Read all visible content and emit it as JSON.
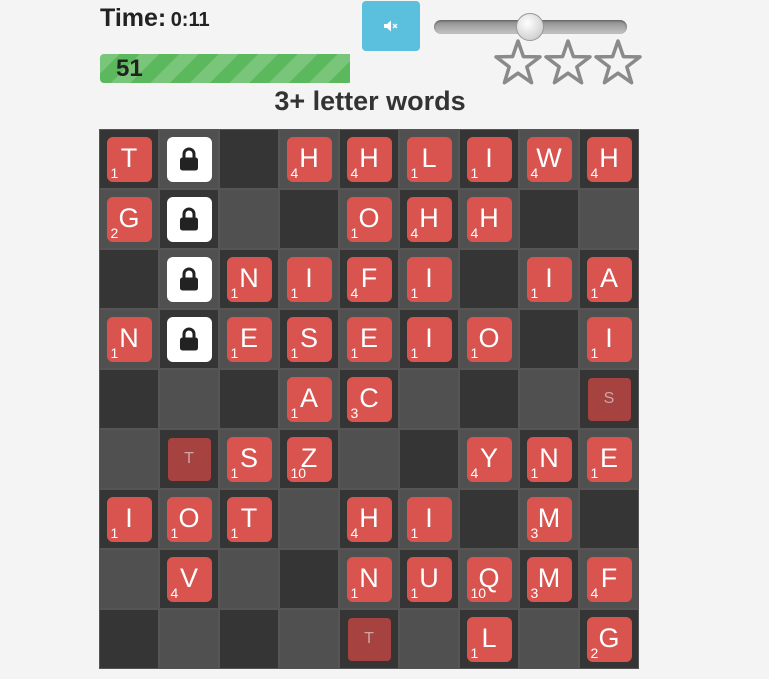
{
  "header": {
    "time_label": "Time:",
    "time_value": "0:11",
    "mute_icon": "speaker-muted-icon",
    "volume": 0.5
  },
  "progress": {
    "value": "51",
    "fraction": 0.5
  },
  "stars": {
    "total": 3,
    "filled": 0
  },
  "heading": "3+ letter words",
  "colors": {
    "tile": "#d9534f",
    "ghost_tile": "#a64341",
    "mute_button": "#5bc0de",
    "progress": "#5cb85c"
  },
  "board": {
    "rows": [
      [
        {
          "t": "tile",
          "l": "T",
          "s": "1"
        },
        {
          "t": "lock"
        },
        {
          "t": "empty"
        },
        {
          "t": "tile",
          "l": "H",
          "s": "4"
        },
        {
          "t": "tile",
          "l": "H",
          "s": "4"
        },
        {
          "t": "tile",
          "l": "L",
          "s": "1"
        },
        {
          "t": "tile",
          "l": "I",
          "s": "1"
        },
        {
          "t": "tile",
          "l": "W",
          "s": "4"
        },
        {
          "t": "tile",
          "l": "H",
          "s": "4"
        }
      ],
      [
        {
          "t": "tile",
          "l": "G",
          "s": "2"
        },
        {
          "t": "lock"
        },
        {
          "t": "empty"
        },
        {
          "t": "empty"
        },
        {
          "t": "tile",
          "l": "O",
          "s": "1"
        },
        {
          "t": "tile",
          "l": "H",
          "s": "4"
        },
        {
          "t": "tile",
          "l": "H",
          "s": "4"
        },
        {
          "t": "empty"
        },
        {
          "t": "empty"
        }
      ],
      [
        {
          "t": "empty"
        },
        {
          "t": "lock"
        },
        {
          "t": "tile",
          "l": "N",
          "s": "1"
        },
        {
          "t": "tile",
          "l": "I",
          "s": "1"
        },
        {
          "t": "tile",
          "l": "F",
          "s": "4"
        },
        {
          "t": "tile",
          "l": "I",
          "s": "1"
        },
        {
          "t": "empty"
        },
        {
          "t": "tile",
          "l": "I",
          "s": "1"
        },
        {
          "t": "tile",
          "l": "A",
          "s": "1"
        }
      ],
      [
        {
          "t": "tile",
          "l": "N",
          "s": "1"
        },
        {
          "t": "lock"
        },
        {
          "t": "tile",
          "l": "E",
          "s": "1"
        },
        {
          "t": "tile",
          "l": "S",
          "s": "1"
        },
        {
          "t": "tile",
          "l": "E",
          "s": "1"
        },
        {
          "t": "tile",
          "l": "I",
          "s": "1"
        },
        {
          "t": "tile",
          "l": "O",
          "s": "1"
        },
        {
          "t": "empty"
        },
        {
          "t": "tile",
          "l": "I",
          "s": "1"
        }
      ],
      [
        {
          "t": "empty"
        },
        {
          "t": "empty"
        },
        {
          "t": "empty"
        },
        {
          "t": "tile",
          "l": "A",
          "s": "1"
        },
        {
          "t": "tile",
          "l": "C",
          "s": "3"
        },
        {
          "t": "empty"
        },
        {
          "t": "empty"
        },
        {
          "t": "empty"
        },
        {
          "t": "ghost",
          "l": "S"
        }
      ],
      [
        {
          "t": "empty"
        },
        {
          "t": "ghost",
          "l": "T"
        },
        {
          "t": "tile",
          "l": "S",
          "s": "1"
        },
        {
          "t": "tile",
          "l": "Z",
          "s": "10"
        },
        {
          "t": "empty"
        },
        {
          "t": "empty"
        },
        {
          "t": "tile",
          "l": "Y",
          "s": "4"
        },
        {
          "t": "tile",
          "l": "N",
          "s": "1"
        },
        {
          "t": "tile",
          "l": "E",
          "s": "1"
        }
      ],
      [
        {
          "t": "tile",
          "l": "I",
          "s": "1"
        },
        {
          "t": "tile",
          "l": "O",
          "s": "1"
        },
        {
          "t": "tile",
          "l": "T",
          "s": "1"
        },
        {
          "t": "empty"
        },
        {
          "t": "tile",
          "l": "H",
          "s": "4"
        },
        {
          "t": "tile",
          "l": "I",
          "s": "1"
        },
        {
          "t": "empty"
        },
        {
          "t": "tile",
          "l": "M",
          "s": "3"
        },
        {
          "t": "empty"
        }
      ],
      [
        {
          "t": "empty"
        },
        {
          "t": "tile",
          "l": "V",
          "s": "4"
        },
        {
          "t": "empty"
        },
        {
          "t": "empty"
        },
        {
          "t": "tile",
          "l": "N",
          "s": "1"
        },
        {
          "t": "tile",
          "l": "U",
          "s": "1"
        },
        {
          "t": "tile",
          "l": "Q",
          "s": "10"
        },
        {
          "t": "tile",
          "l": "M",
          "s": "3"
        },
        {
          "t": "tile",
          "l": "F",
          "s": "4"
        }
      ],
      [
        {
          "t": "empty"
        },
        {
          "t": "empty"
        },
        {
          "t": "empty"
        },
        {
          "t": "empty"
        },
        {
          "t": "ghost",
          "l": "T"
        },
        {
          "t": "empty"
        },
        {
          "t": "tile",
          "l": "L",
          "s": "1"
        },
        {
          "t": "empty"
        },
        {
          "t": "tile",
          "l": "G",
          "s": "2"
        }
      ]
    ]
  }
}
